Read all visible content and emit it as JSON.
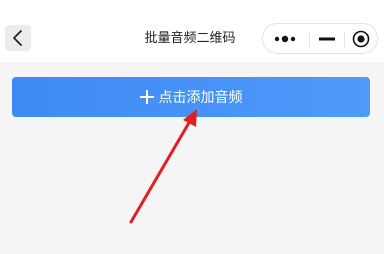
{
  "nav": {
    "title": "批量音频二维码",
    "back_icon": "chevron-left-icon",
    "capsule": {
      "more_icon": "more-dots-icon",
      "minimize_icon": "minimize-icon",
      "close_icon": "target-close-icon"
    }
  },
  "main": {
    "add_audio_label": "点击添加音频",
    "add_icon": "plus-icon",
    "button_color": "#4a94f7",
    "annotation_arrow_color": "#e02020"
  }
}
